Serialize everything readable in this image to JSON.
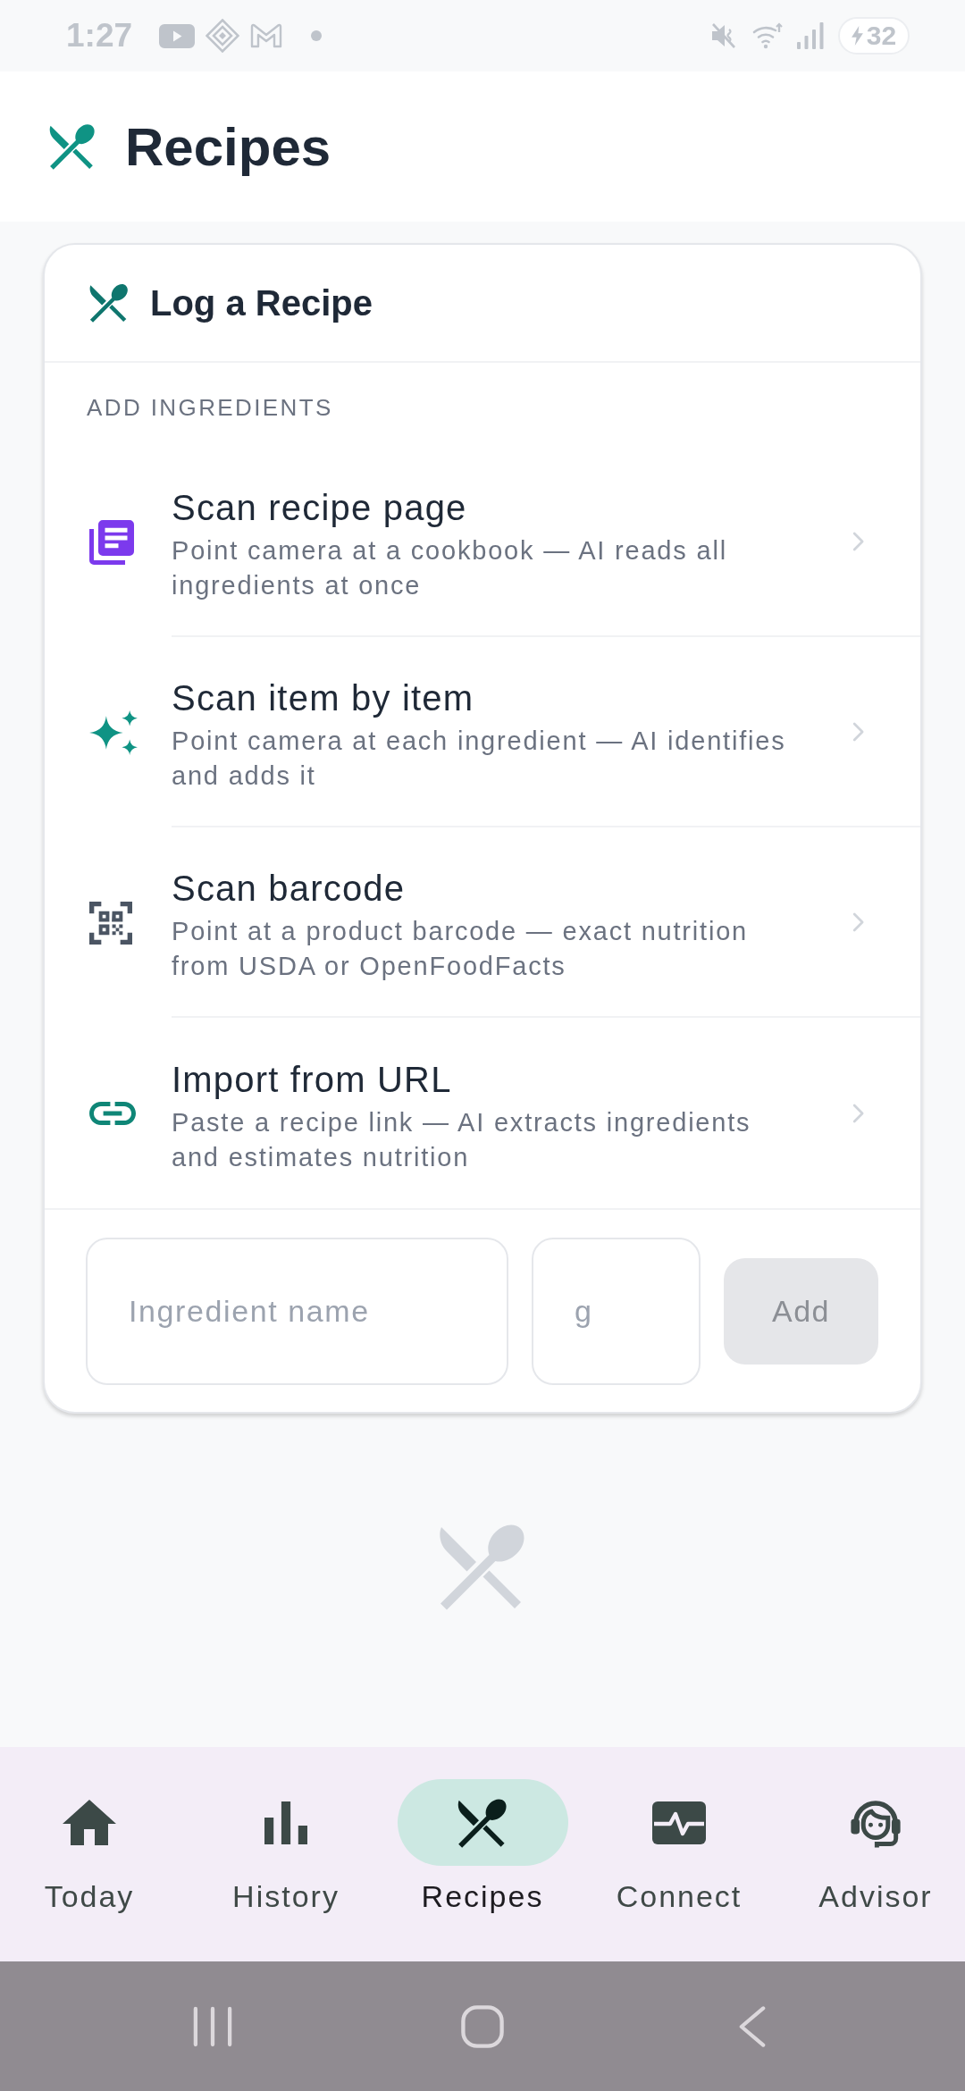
{
  "status_bar": {
    "time": "1:27",
    "battery": "32"
  },
  "header": {
    "title": "Recipes"
  },
  "card": {
    "title": "Log a Recipe",
    "section_label": "ADD INGREDIENTS",
    "options": [
      {
        "kind": "scan_page",
        "title": "Scan recipe page",
        "description": "Point camera at a cookbook — AI reads all ingredients at once"
      },
      {
        "kind": "scan_item",
        "title": "Scan item by item",
        "description": "Point camera at each ingredient — AI identifies and adds it"
      },
      {
        "kind": "barcode",
        "title": "Scan barcode",
        "description": "Point at a product barcode — exact nutrition from USDA or OpenFoodFacts"
      },
      {
        "kind": "url",
        "title": "Import from URL",
        "description": "Paste a recipe link — AI extracts ingredients and estimates nutrition"
      }
    ],
    "form": {
      "name_placeholder": "Ingredient name",
      "amount_placeholder": "g",
      "add_button": {
        "label": "Add",
        "disabled": true
      }
    }
  },
  "bottom_nav": [
    {
      "kind": "home",
      "label": "Today",
      "selected": false
    },
    {
      "kind": "chart",
      "label": "History",
      "selected": false
    },
    {
      "kind": "recipes",
      "label": "Recipes",
      "selected": true
    },
    {
      "kind": "monitor",
      "label": "Connect",
      "selected": false
    },
    {
      "kind": "advisor",
      "label": "Advisor",
      "selected": false
    }
  ]
}
